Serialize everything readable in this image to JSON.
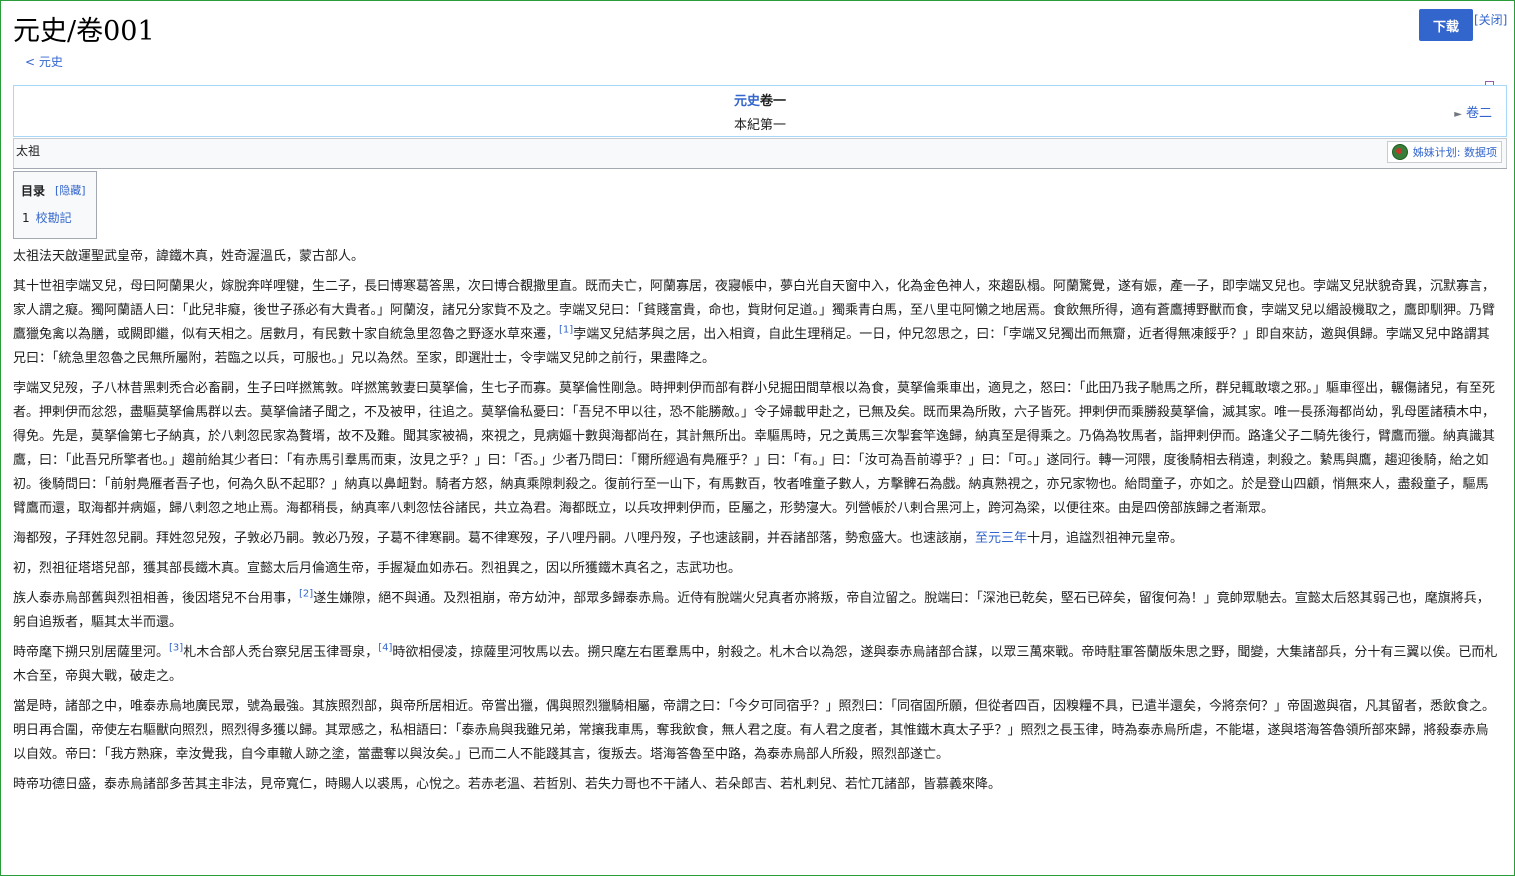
{
  "page": {
    "title": "元史/卷001",
    "download_label": "下载",
    "close_label": "[关闭]",
    "back_label": "< 元史"
  },
  "header": {
    "book": "元史",
    "volume": "卷一",
    "section": "本紀第一",
    "next": "卷二"
  },
  "notes": {
    "text": "太祖",
    "sister_label": "姊妹计划: 数据项"
  },
  "toc": {
    "title": "目录",
    "hide": "[隐藏]",
    "item_num": "1",
    "item_label": "校勘記"
  },
  "refs": [
    "[1]",
    "[2]",
    "[3]",
    "[4]"
  ],
  "link_zhiyuan": "至元三年",
  "paragraphs": {
    "p1": "太祖法天啟運聖武皇帝，諱鐵木真，姓奇渥溫氏，蒙古部人。",
    "p2a": "其十世祖孛端叉兒，母曰阿蘭果火，嫁脫奔咩哩犍，生二子，長曰博寒葛答黑，次曰博合覩撒里直。既而夫亡，阿蘭寡居，夜寢帳中，夢白光自天窗中入，化為金色神人，來趨臥榻。阿蘭驚覺，遂有娠，產一子，即孛端叉兒也。孛端叉兒狀貌奇異，沉默寡言，家人謂之癡。獨阿蘭語人曰：「此兒非癡，後世子孫必有大貴者。」阿蘭沒，諸兄分家貲不及之。孛端叉兒曰：「貧賤富貴，命也，貲財何足道。」獨乘青白馬，至八里屯阿懶之地居焉。食飲無所得，適有蒼鷹搏野獸而食，孛端叉兒以緡設機取之，鷹即馴狎。乃臂鷹獵兔禽以為膳，或闕即繼，似有天相之。居數月，有民數十家自統急里忽魯之野逐水草來遷，",
    "p2b": "孛端叉兒結茅與之居，出入相資，自此生理稍足。一日，仲兄忽思之，曰：「孛端叉兒獨出而無齎，近者得無凍餒乎？」即自來訪，邀與俱歸。孛端叉兒中路謂其兄曰：「統急里忽魯之民無所屬附，若臨之以兵，可服也。」兄以為然。至家，即選壯士，令孛端叉兒帥之前行，果盡降之。",
    "p3": "孛端叉兒歿，子八林昔黑剌禿合必畜嗣，生子曰咩撚篤敦。咩撚篤敦妻曰莫拏倫，生七子而寡。莫拏倫性剛急。時押剌伊而部有群小兒掘田間草根以為食，莫拏倫乘車出，適見之，怒曰：「此田乃我子馳馬之所，群兒輒敢壞之邪。」驅車徑出，輾傷諸兒，有至死者。押剌伊而忿怨，盡驅莫拏倫馬群以去。莫拏倫諸子聞之，不及被甲，往追之。莫拏倫私憂曰：「吾兒不甲以往，恐不能勝敵。」令子婦載甲赴之，已無及矣。既而果為所敗，六子皆死。押剌伊而乘勝殺莫拏倫，滅其家。唯一長孫海都尚幼，乳母匿諸積木中，得免。先是，莫拏倫第七子納真，於八剌忽民家為贅壻，故不及難。聞其家被禍，來視之，見病嫗十數與海都尚在，其計無所出。幸驅馬時，兄之黃馬三次掣套竿逸歸，納真至是得乘之。乃偽為牧馬者，詣押剌伊而。路逢父子二騎先後行，臂鷹而獵。納真識其鷹，曰：「此吾兄所擎者也。」趨前紿其少者曰：「有赤馬引羣馬而東，汝見之乎？」曰：「否。」少者乃問曰：「爾所經過有鳧雁乎？」曰：「有。」曰：「汝可為吾前導乎？」曰：「可。」遂同行。轉一河隈，度後騎相去稍遠，刺殺之。縶馬與鷹，趨迎後騎，紿之如初。後騎問曰：「前射鳧雁者吾子也，何為久臥不起耶？」納真以鼻衄對。騎者方怒，納真乘隙刺殺之。復前行至一山下，有馬數百，牧者唯童子數人，方擊髀石為戲。納真熟視之，亦兄家物也。紿問童子，亦如之。於是登山四顧，悄無來人，盡殺童子，驅馬臂鷹而還，取海都并病嫗，歸八剌忽之地止焉。海都稍長，納真率八剌忽怯谷諸民，共立為君。海都既立，以兵攻押剌伊而，臣屬之，形勢寖大。列營帳於八剌合黑河上，跨河為梁，以便往來。由是四傍部族歸之者漸眾。",
    "p4a": "海都歿，子拜姓忽兒嗣。拜姓忽兒歿，子敦必乃嗣。敦必乃歿，子葛不律寒嗣。葛不律寒歿，子八哩丹嗣。八哩丹歿，子也速該嗣，并吞諸部落，勢愈盛大。也速該崩，",
    "p4b": "十月，追諡烈祖神元皇帝。",
    "p5": "初，烈祖征塔塔兒部，獲其部長鐵木真。宣懿太后月倫適生帝，手握凝血如赤石。烈祖異之，因以所獲鐵木真名之，志武功也。",
    "p6a": "族人泰赤烏部舊與烈祖相善，後因塔兒不台用事，",
    "p6b": "遂生嫌隙，絕不與通。及烈祖崩，帝方幼沖，部眾多歸泰赤烏。近侍有脫端火兒真者亦將叛，帝自泣留之。脫端曰：「深池已乾矣，堅石已碎矣，留復何為！」竟帥眾馳去。宣懿太后怒其弱己也，麾旗將兵，躬自追叛者，驅其太半而還。",
    "p7a": "時帝麾下搠只別居薩里河。",
    "p7b": "札木合部人禿台察兒居玉律哥泉，",
    "p7c": "時欲相侵凌，掠薩里河牧馬以去。搠只麾左右匿羣馬中，射殺之。札木合以為怨，遂與泰赤烏諸部合謀，以眾三萬來戰。帝時駐軍答蘭版朱思之野，聞變，大集諸部兵，分十有三翼以俟。已而札木合至，帝與大戰，破走之。",
    "p8": "當是時，諸部之中，唯泰赤烏地廣民眾，號為最強。其族照烈部，與帝所居相近。帝嘗出獵，偶與照烈獵騎相屬，帝謂之曰：「今夕可同宿乎？」照烈曰：「同宿固所願，但從者四百，因糗糧不具，已遣半還矣，今將奈何？」帝固邀與宿，凡其留者，悉飲食之。明日再合圍，帝使左右驅獸向照烈，照烈得多獲以歸。其眾感之，私相語曰：「泰赤烏與我雖兄弟，常攘我車馬，奪我飲食，無人君之度。有人君之度者，其惟鐵木真太子乎？」照烈之長玉律，時為泰赤烏所虐，不能堪，遂與塔海答魯領所部來歸，將殺泰赤烏以自效。帝曰：「我方熟寐，幸汝覺我，自今車轍人跡之塗，當盡奪以與汝矣。」已而二人不能踐其言，復叛去。塔海答魯至中路，為泰赤烏部人所殺，照烈部遂亡。",
    "p9": "時帝功德日盛，泰赤烏諸部多苦其主非法，見帝寬仁，時賜人以裘馬，心悅之。若赤老溫、若哲別、若失力哥也不干諸人、若朵郎吉、若札剌兒、若忙兀諸部，皆慕義來降。"
  }
}
